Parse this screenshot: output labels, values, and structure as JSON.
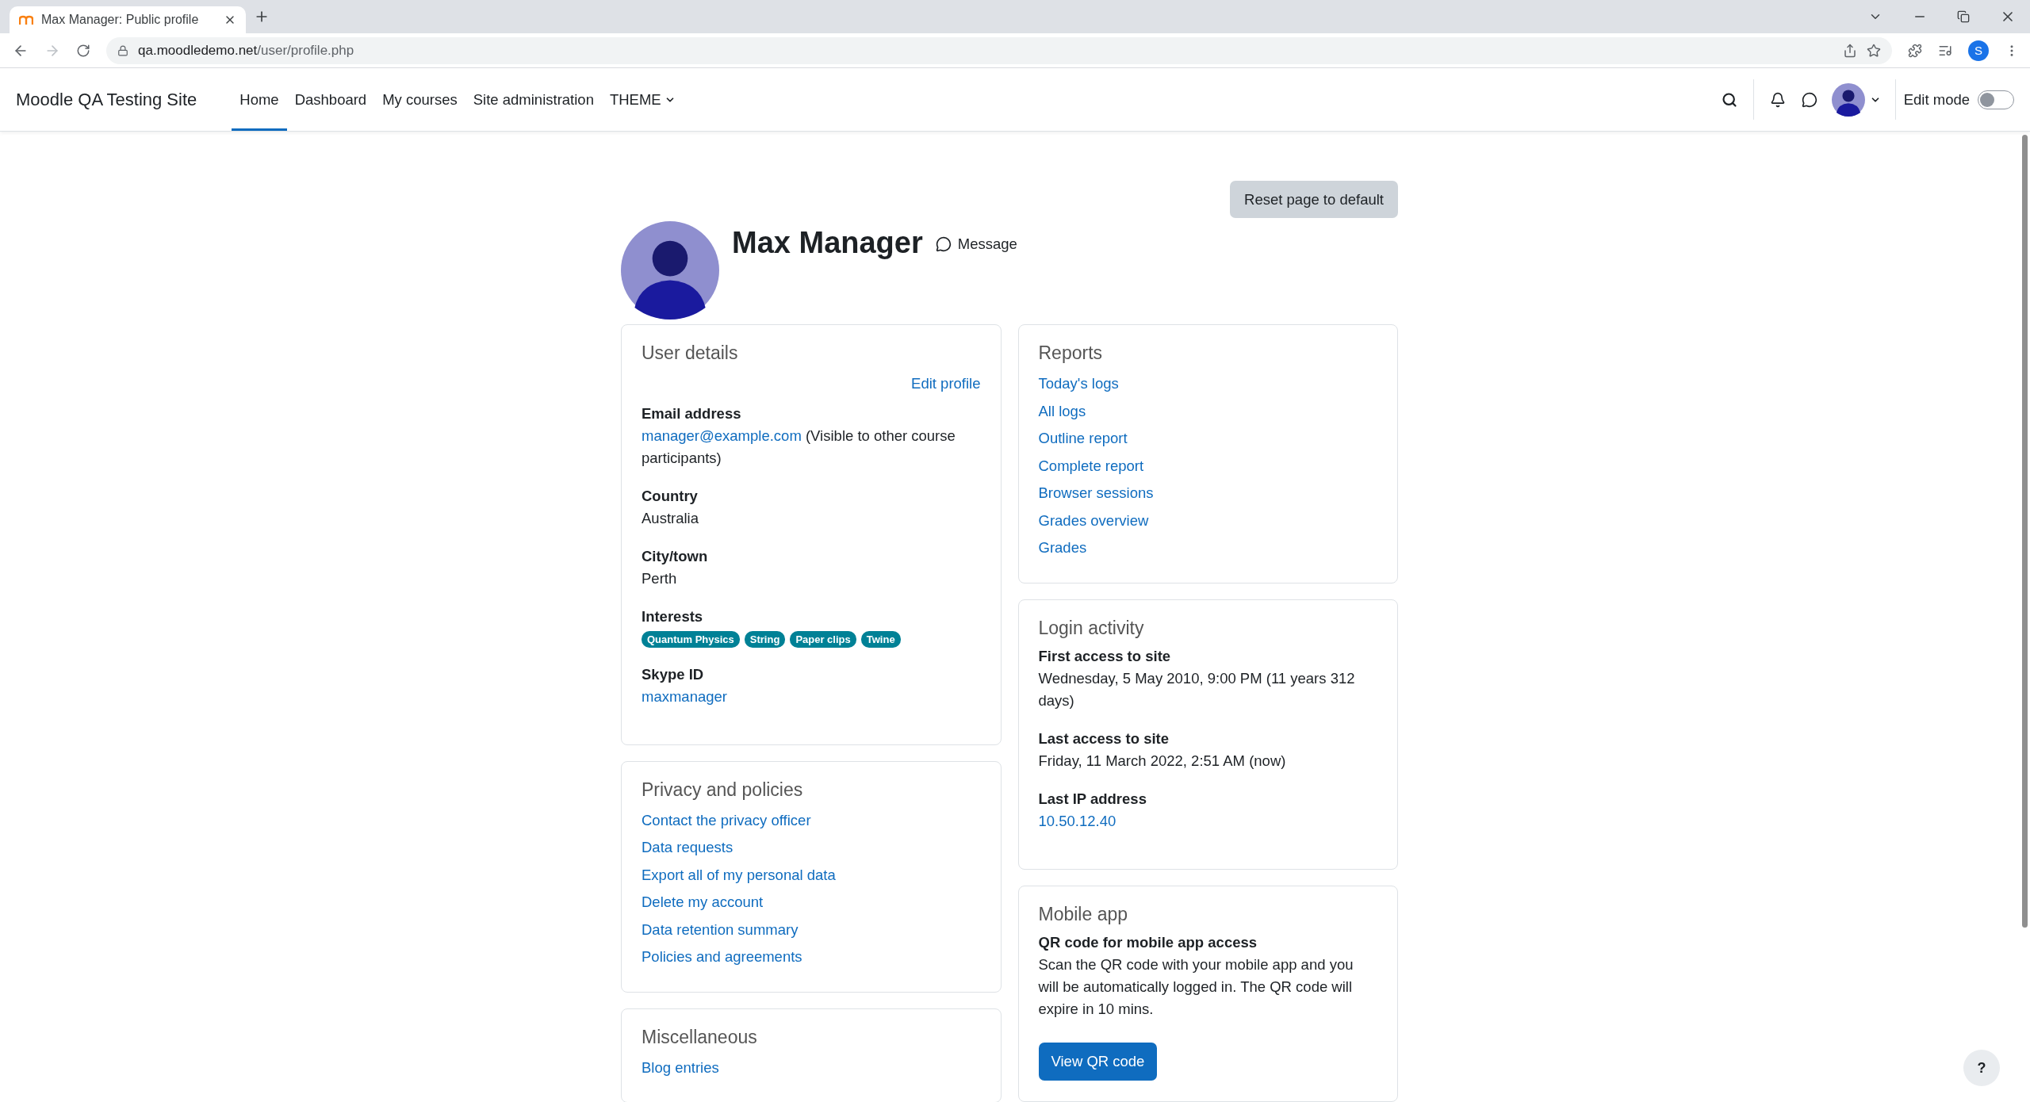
{
  "browser": {
    "tab_title": "Max Manager: Public profile",
    "url_host": "qa.moodledemo.net",
    "url_path": "/user/profile.php",
    "profile_initial": "S"
  },
  "navbar": {
    "site_name": "Moodle QA Testing Site",
    "items": [
      {
        "label": "Home",
        "selected": true,
        "dropdown": false
      },
      {
        "label": "Dashboard",
        "selected": false,
        "dropdown": false
      },
      {
        "label": "My courses",
        "selected": false,
        "dropdown": false
      },
      {
        "label": "Site administration",
        "selected": false,
        "dropdown": false
      },
      {
        "label": "THEME",
        "selected": false,
        "dropdown": true
      }
    ],
    "edit_mode": {
      "label": "Edit mode",
      "on": false
    }
  },
  "reset_button": "Reset page to default",
  "profile": {
    "name": "Max Manager",
    "message": "Message"
  },
  "left_cards": [
    {
      "title": "User details",
      "action": "Edit profile",
      "items": [
        {
          "kind": "field",
          "label": "Email address",
          "value": "manager@example.com",
          "link": true,
          "note": "(Visible to other course participants)"
        },
        {
          "kind": "field",
          "label": "Country",
          "value": "Australia",
          "link": false
        },
        {
          "kind": "field",
          "label": "City/town",
          "value": "Perth",
          "link": false
        },
        {
          "kind": "tags",
          "label": "Interests",
          "tags": [
            "Quantum Physics",
            "String",
            "Paper clips",
            "Twine"
          ]
        },
        {
          "kind": "field",
          "label": "Skype ID",
          "value": "maxmanager",
          "link": true
        }
      ]
    },
    {
      "title": "Privacy and policies",
      "items": [
        {
          "kind": "link",
          "text": "Contact the privacy officer"
        },
        {
          "kind": "link",
          "text": "Data requests"
        },
        {
          "kind": "link",
          "text": "Export all of my personal data"
        },
        {
          "kind": "link",
          "text": "Delete my account"
        },
        {
          "kind": "link",
          "text": "Data retention summary"
        },
        {
          "kind": "link",
          "text": "Policies and agreements"
        }
      ]
    },
    {
      "title": "Miscellaneous",
      "items": [
        {
          "kind": "link",
          "text": "Blog entries"
        }
      ]
    }
  ],
  "right_cards": [
    {
      "title": "Reports",
      "items": [
        {
          "kind": "link",
          "text": "Today's logs"
        },
        {
          "kind": "link",
          "text": "All logs"
        },
        {
          "kind": "link",
          "text": "Outline report"
        },
        {
          "kind": "link",
          "text": "Complete report"
        },
        {
          "kind": "link",
          "text": "Browser sessions"
        },
        {
          "kind": "link",
          "text": "Grades overview"
        },
        {
          "kind": "link",
          "text": "Grades"
        }
      ]
    },
    {
      "title": "Login activity",
      "items": [
        {
          "kind": "field",
          "label": "First access to site",
          "value": "Wednesday, 5 May 2010, 9:00 PM  (11 years 312 days)",
          "link": false
        },
        {
          "kind": "field",
          "label": "Last access to site",
          "value": "Friday, 11 March 2022, 2:51 AM  (now)",
          "link": false
        },
        {
          "kind": "field",
          "label": "Last IP address",
          "value": "10.50.12.40",
          "link": true
        }
      ]
    },
    {
      "title": "Mobile app",
      "items": [
        {
          "kind": "field",
          "label": "QR code for mobile app access",
          "value": "Scan the QR code with your mobile app and you will be automatically logged in. The QR code will expire in 10 mins.",
          "link": false
        },
        {
          "kind": "button",
          "text": "View QR code"
        }
      ]
    }
  ],
  "help_button": "?"
}
